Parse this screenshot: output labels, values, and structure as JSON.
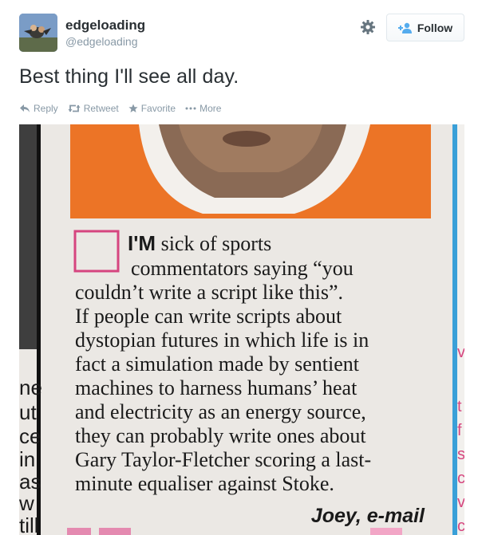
{
  "user": {
    "display_name": "edgeloading",
    "handle": "@edgeloading"
  },
  "header": {
    "follow_label": "Follow"
  },
  "tweet": {
    "text": "Best thing I'll see all day."
  },
  "actions": {
    "reply": "Reply",
    "retweet": "Retweet",
    "favorite": "Favorite",
    "more": "More"
  },
  "photo": {
    "letter_line1_bold": "I'M",
    "letter_line1_rest": " sick of sports",
    "letter_lines": [
      "commentators saying “you",
      "couldn’t write a script like this”.",
      "If people can write scripts about",
      "dystopian futures in which life is in",
      "fact a simulation made by sentient",
      "machines to harness humans’ heat",
      "and electricity as an energy source,",
      "they can probably write ones about",
      "Gary Taylor-Fletcher scoring a last-",
      "minute equaliser against Stoke."
    ],
    "signature": "Joey, e-mail",
    "left_column_fragments": [
      "ne",
      "ut",
      "ce",
      "in",
      "as",
      "w",
      "till"
    ],
    "right_column_fragments": [
      "v",
      "t",
      "f",
      "s",
      "c",
      "v",
      "c"
    ]
  },
  "colors": {
    "accent": "#55acee",
    "text": "#292f33",
    "muted": "#8899a6",
    "checkbox": "#d6457f",
    "newspaper_blue": "#3aa0d8"
  }
}
